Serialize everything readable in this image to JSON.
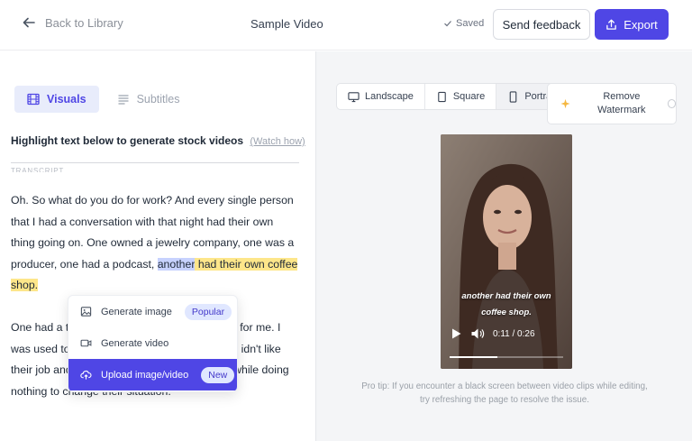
{
  "header": {
    "back_label": "Back to Library",
    "title": "Sample Video",
    "saved_label": "Saved",
    "feedback_label": "Send feedback",
    "export_label": "Export"
  },
  "left_panel": {
    "tabs": [
      {
        "label": "Visuals",
        "icon": "film-icon",
        "active": true
      },
      {
        "label": "Subtitles",
        "icon": "lines-icon",
        "active": false
      }
    ],
    "hint": "Highlight text below to generate stock videos",
    "watch_link": "(Watch how)",
    "transcript_label": "TRANSCRIPT",
    "paragraph1_a": "Oh. So what do you do for work? And every single person that I had a conversation with that night had their own thing going on. One owned a jewelry company, one was a producer, one had a podcast, ",
    "paragraph1_hl_blue": "another",
    "paragraph1_hl_yellow": " had their own coffee shop.",
    "paragraph2_a": "One had a t",
    "paragraph2_b": "for me. I was used to",
    "paragraph2_c": "idn't like their job and",
    "paragraph2_d": " while doing nothing to change their situation."
  },
  "context_menu": {
    "items": [
      {
        "label": "Generate image",
        "icon": "image-icon",
        "badge": "Popular"
      },
      {
        "label": "Generate video",
        "icon": "video-icon",
        "badge": ""
      },
      {
        "label": "Upload image/video",
        "icon": "upload-cloud-icon",
        "badge": "New",
        "selected": true
      }
    ]
  },
  "right_panel": {
    "aspect_options": [
      {
        "label": "Landscape",
        "icon": "monitor-icon",
        "active": false
      },
      {
        "label": "Square",
        "icon": "square-icon",
        "active": false
      },
      {
        "label": "Portrait",
        "icon": "phone-icon",
        "active": true
      }
    ],
    "watermark_label": "Remove Watermark",
    "video": {
      "caption_line1": "another had their own",
      "caption_line2": "coffee shop.",
      "time": "0:11 / 0:26",
      "progress": 0.42
    },
    "protip": "Pro tip: If you encounter a black screen between video clips while editing, try refreshing the page to resolve the issue."
  },
  "colors": {
    "accent": "#4f46e5",
    "highlight_blue": "#c7d2fe",
    "highlight_yellow": "#fde68a"
  }
}
